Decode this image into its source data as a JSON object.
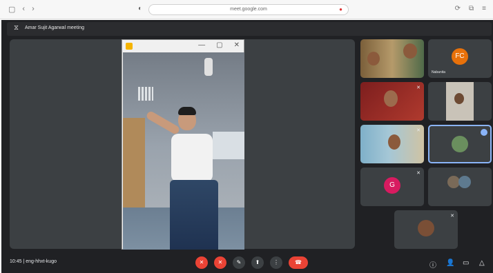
{
  "browser": {
    "address_text": "meet.google.com",
    "nav_back": "‹",
    "nav_forward": "›",
    "tab_icon": "▢"
  },
  "meeting": {
    "title": "Amar Sujit Agarwal meeting",
    "time_code": "10:45 | eng-hhxt-kugo"
  },
  "participants": [
    {
      "label": "",
      "avatar_letter": ""
    },
    {
      "label": "Nabanita",
      "avatar_letter": "FC",
      "avatar_color": "#e8710a"
    },
    {
      "label": "",
      "avatar_letter": ""
    },
    {
      "label": "",
      "avatar_letter": ""
    },
    {
      "label": "",
      "avatar_letter": ""
    },
    {
      "label": "",
      "avatar_letter": ""
    },
    {
      "label": "",
      "avatar_letter": "G",
      "avatar_color": "#d81b60"
    },
    {
      "label": "",
      "avatar_letter": ""
    },
    {
      "label": "",
      "avatar_letter": ""
    }
  ],
  "controls": {
    "mic": "✕",
    "camera": "✕",
    "captions": "✎",
    "present": "⬆",
    "more": "⋮",
    "end": "☎"
  },
  "icons": {
    "info": "ⓘ",
    "people": "👤",
    "chat": "▭",
    "activities": "△"
  },
  "colors": {
    "accent": "#8ab4f8",
    "danger": "#ea4335",
    "surface": "#3c4043",
    "background": "#202124"
  }
}
